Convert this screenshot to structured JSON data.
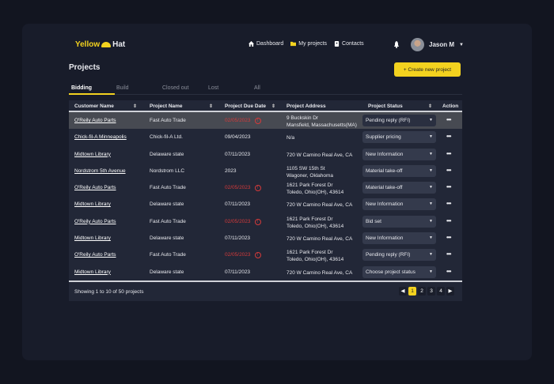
{
  "logo": {
    "part1": "Yellow",
    "part2": "Hat"
  },
  "nav": [
    {
      "label": "Dashboard",
      "icon": "home-icon"
    },
    {
      "label": "My projects",
      "icon": "folder-icon"
    },
    {
      "label": "Contacts",
      "icon": "contacts-icon"
    }
  ],
  "user": {
    "name": "Jason M"
  },
  "page_title": "Projects",
  "create_button": "+   Create new project",
  "tabs": [
    "Bidding",
    "Build",
    "Closed out",
    "Lost",
    "All"
  ],
  "columns": [
    "Customer Name",
    "Project Name",
    "Project Due Date",
    "Project Address",
    "Project Status",
    "Action"
  ],
  "rows": [
    {
      "customer": "O'Reily Auto Parts",
      "project": "Fast Auto Trade",
      "due": "02/05/2023",
      "overdue": true,
      "addr1": "9 Buckskin Dr",
      "addr2": "Mansfield, Massachusetts(MA)",
      "status": "Pending reply (RFI)"
    },
    {
      "customer": "Chick-fil-A Minneapolis",
      "project": "Chick-fil-A Ltd.",
      "due": "09/04/2023",
      "overdue": false,
      "addr1": "N/a",
      "addr2": "",
      "status": "Supplier pricing"
    },
    {
      "customer": "Midtown Library",
      "project": "Delaware state",
      "due": "07/11/2023",
      "overdue": false,
      "addr1": "720 W Camino Real Ave, CA",
      "addr2": "",
      "status": "New Information"
    },
    {
      "customer": "Nordstrom 5th Avenue",
      "project": "Nordstrom LLC",
      "due": "2023",
      "overdue": false,
      "addr1": "1105 SW 15th St",
      "addr2": "Wagoner, Oklahoma",
      "status": "Material take-off"
    },
    {
      "customer": "O'Reily Auto Parts",
      "project": "Fast Auto Trade",
      "due": "02/05/2023",
      "overdue": true,
      "addr1": "1621 Park Forest Dr",
      "addr2": "Toledo, Ohio(OH), 43614",
      "status": "Material take-off"
    },
    {
      "customer": "Midtown Library",
      "project": "Delaware state",
      "due": "07/11/2023",
      "overdue": false,
      "addr1": "720 W Camino Real Ave, CA",
      "addr2": "",
      "status": "New Information"
    },
    {
      "customer": "O'Reily Auto Parts",
      "project": "Fast Auto Trade",
      "due": "02/05/2023",
      "overdue": true,
      "addr1": "1621 Park Forest Dr",
      "addr2": "Toledo, Ohio(OH), 43614",
      "status": "Bid set"
    },
    {
      "customer": "Midtown Library",
      "project": "Delaware state",
      "due": "07/11/2023",
      "overdue": false,
      "addr1": "720 W Camino Real Ave, CA",
      "addr2": "",
      "status": "New Information"
    },
    {
      "customer": "O'Reily Auto Parts",
      "project": "Fast Auto Trade",
      "due": "02/05/2023",
      "overdue": true,
      "addr1": "1621 Park Forest Dr",
      "addr2": "Toledo, Ohio(OH), 43614",
      "status": "Pending reply (RFI)"
    },
    {
      "customer": "Midtown Library",
      "project": "Delaware state",
      "due": "07/11/2023",
      "overdue": false,
      "addr1": "720 W Camino Real Ave, CA",
      "addr2": "",
      "status": "Choose project status"
    }
  ],
  "footer": {
    "info": "Showing 1 to 10 of 50 projects",
    "pages": [
      "1",
      "2",
      "3",
      "4"
    ],
    "current": "1"
  },
  "colors": {
    "accent": "#f3d21f",
    "overdue": "#d43a3a"
  }
}
